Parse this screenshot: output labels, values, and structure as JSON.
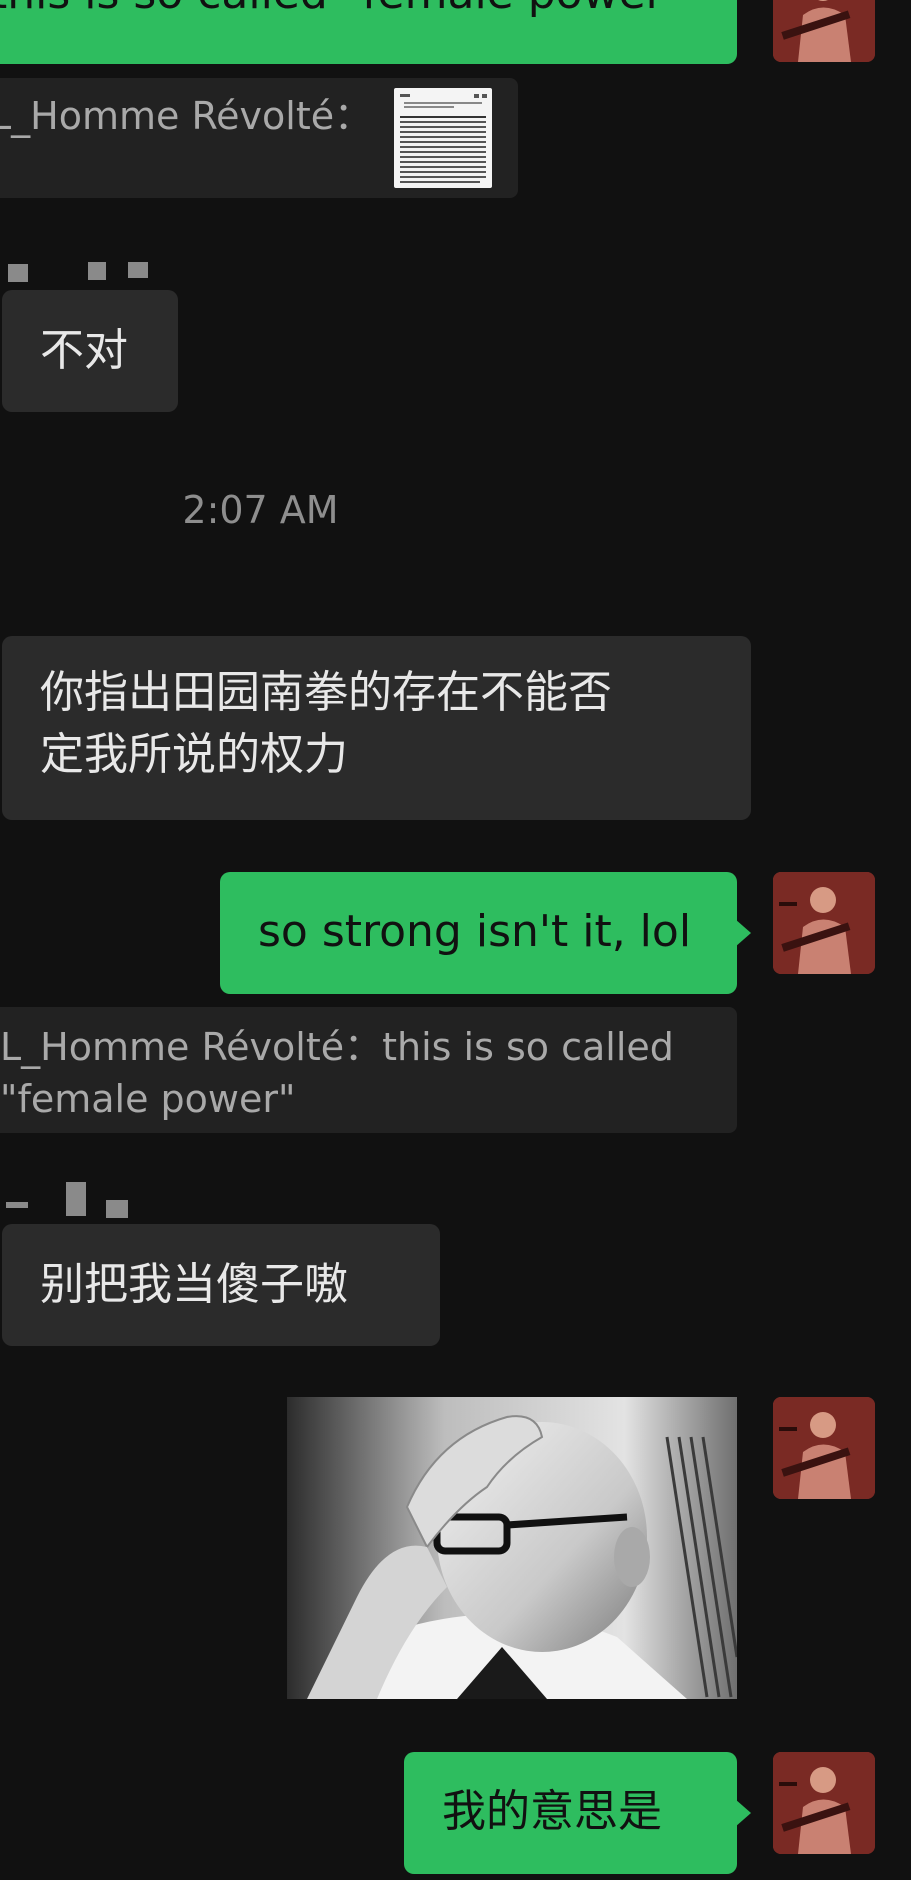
{
  "messages": {
    "top_partial": "this is so called \"female power\"",
    "quote1_name": "L_Homme Révolté：",
    "msg_incorrect": "不对",
    "timestamp": "2:07 AM",
    "msg_long_line1": "你指出田园南拳的存在不能否",
    "msg_long_line2": "定我所说的权力",
    "msg_strong": "so strong isn't it, lol",
    "quote2_line1": "L_Homme Révolté：this is so called",
    "quote2_line2": "\"female power\"",
    "msg_dont_treat": "别把我当傻子嗷",
    "msg_i_mean": "我的意思是"
  },
  "colors": {
    "background": "#111111",
    "outgoing_bubble": "#2ebd5f",
    "incoming_bubble": "#2b2b2b",
    "quote_bg": "#222222",
    "timestamp": "#8e8e8e"
  },
  "icons": {
    "avatar": "guitarist-avatar",
    "photo": "man-hand-on-forehead-photo",
    "doc_thumb": "document-thumbnail"
  }
}
